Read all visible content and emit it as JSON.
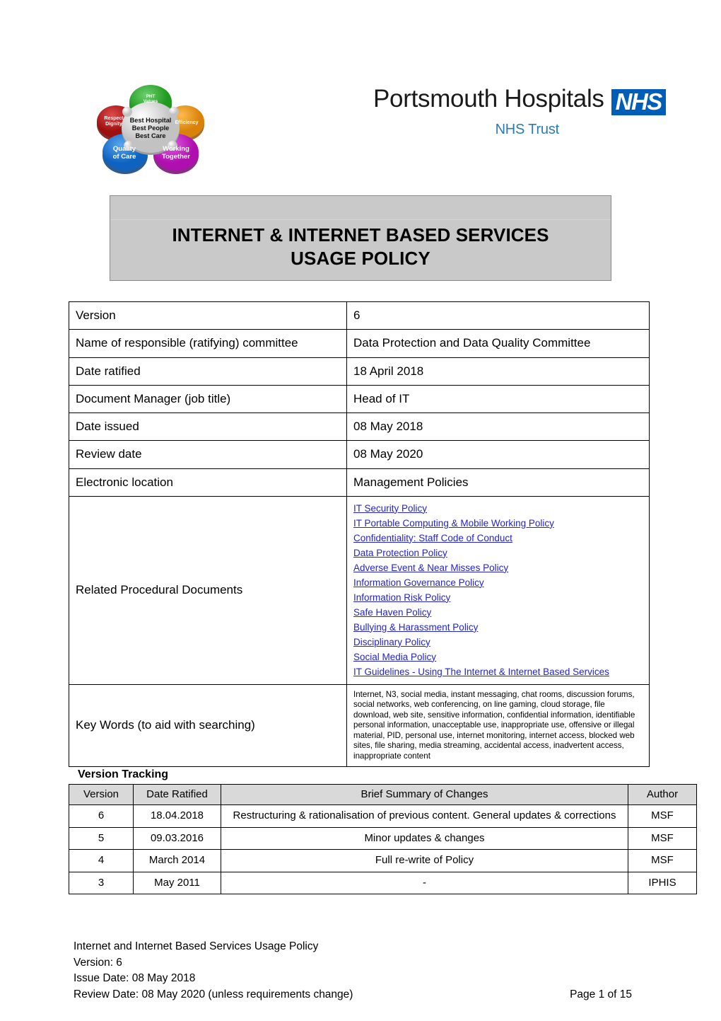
{
  "header": {
    "pht_logo": {
      "center_lines": [
        "Best Hospital",
        "Best People",
        "Best Care"
      ],
      "petals": [
        {
          "label_lines": [
            "PHT",
            "Values"
          ],
          "color": "#2aa82a"
        },
        {
          "label_lines": [
            "Respect",
            "Dignity"
          ],
          "color": "#b81a1a"
        },
        {
          "label_lines": [
            "Efficiency"
          ],
          "color": "#e8930e"
        },
        {
          "label_lines": [
            "Quality",
            "of Care"
          ],
          "color": "#1878d8"
        },
        {
          "label_lines": [
            "Working",
            "Together"
          ],
          "color": "#c818c8"
        }
      ]
    },
    "nhs_logo": {
      "trust_name": "Portsmouth Hospitals",
      "badge": "NHS",
      "sub": "NHS Trust",
      "badge_color": "#005eb8",
      "sub_color": "#2a7ab8"
    }
  },
  "title": {
    "line1": "INTERNET & INTERNET BASED SERVICES",
    "line2": "USAGE POLICY",
    "background": "#c9c9c9"
  },
  "meta": {
    "rows": [
      {
        "key": "Version",
        "value": "6"
      },
      {
        "key": "Name of responsible (ratifying) committee",
        "value": "Data Protection and Data Quality Committee"
      },
      {
        "key": "Date ratified",
        "value": "18 April 2018"
      },
      {
        "key": "Document Manager (job title)",
        "value": "Head of IT"
      },
      {
        "key": "Date issued",
        "value": "08 May 2018"
      },
      {
        "key": "Review date",
        "value": "08 May 2020"
      },
      {
        "key": "Electronic location",
        "value": "Management Policies"
      }
    ],
    "related_label": "Related Procedural Documents",
    "related_links": [
      "IT Security Policy",
      "IT Portable Computing & Mobile Working Policy",
      "Confidentiality: Staff Code of Conduct",
      "Data Protection Policy",
      "Adverse Event & Near Misses Policy",
      "Information Governance Policy",
      "Information Risk Policy",
      "Safe Haven Policy",
      "Bullying & Harassment Policy",
      "Disciplinary Policy",
      "Social Media Policy",
      "IT Guidelines - Using The Internet & Internet Based Services"
    ],
    "link_color": "#2323d6",
    "keywords_label": "Key Words (to aid with searching)",
    "keywords_value": "Internet, N3, social media, instant messaging, chat rooms, discussion forums, social networks, web conferencing, on line gaming, cloud storage, file download, web site, sensitive information, confidential information, identifiable personal information, unacceptable use, inappropriate use, offensive or illegal material, PID, personal use, internet monitoring, internet access, blocked web sites, file sharing, media streaming, accidental access, inadvertent access, inappropriate content"
  },
  "version_tracking": {
    "heading": "Version Tracking",
    "columns": [
      "Version",
      "Date Ratified",
      "Brief Summary of Changes",
      "Author"
    ],
    "header_background": "#d9d9d9",
    "rows": [
      {
        "version": "6",
        "date": "18.04.2018",
        "summary": "Restructuring & rationalisation of previous content. General updates & corrections",
        "author": "MSF"
      },
      {
        "version": "5",
        "date": "09.03.2016",
        "summary": "Minor updates & changes",
        "author": "MSF"
      },
      {
        "version": "4",
        "date": "March 2014",
        "summary": "Full re-write of Policy",
        "author": "MSF"
      },
      {
        "version": "3",
        "date": "May 2011",
        "summary": "-",
        "author": "IPHIS"
      }
    ]
  },
  "footer": {
    "line1": "Internet and Internet Based Services Usage Policy",
    "line2": "Version: 6",
    "line3": "Issue Date: 08 May 2018",
    "line4": "Review Date: 08 May 2020 (unless requirements change)",
    "page": "Page 1 of 15"
  }
}
